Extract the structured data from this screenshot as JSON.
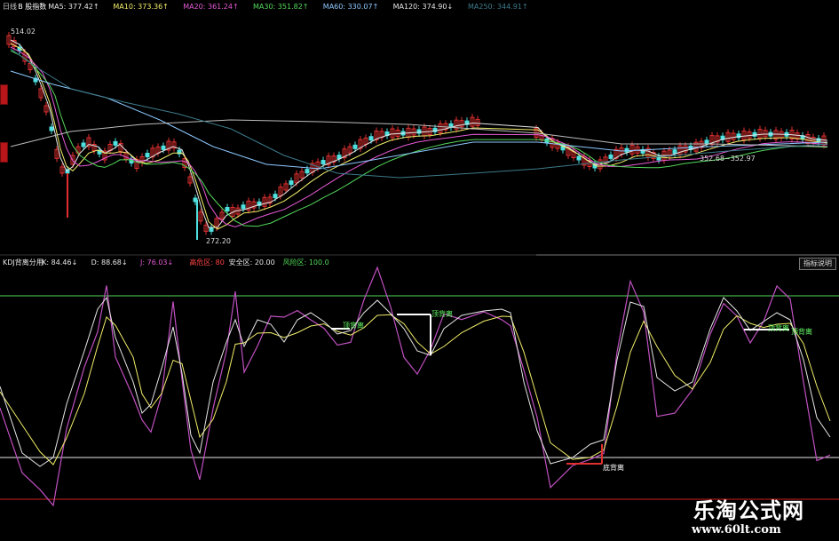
{
  "top_panel": {
    "legend": [
      {
        "text": "日线",
        "color": "#c9c9c9"
      },
      {
        "text": "B 股指数",
        "color": "#ffffff"
      },
      {
        "text": "MA5: 377.42↑",
        "color": "#e6e6e6"
      },
      {
        "text": "MA10: 373.36↑",
        "color": "#f2ee6a"
      },
      {
        "text": "MA20: 361.24↑",
        "color": "#e65ad6"
      },
      {
        "text": "MA30: 351.82↑",
        "color": "#53d85a"
      },
      {
        "text": "MA60: 330.07↑",
        "color": "#8dc8ff"
      },
      {
        "text": "MA120: 374.90↓",
        "color": "#e6e6e6"
      },
      {
        "text": "MA250: 344.91↑",
        "color": "#3d7a8a"
      }
    ],
    "high_label": "514.02",
    "low_label": "272.20",
    "range_label": "352.68~352.97"
  },
  "bottom_panel": {
    "legend": [
      {
        "text": "KDJ背离分用",
        "color": "#e6e6e6"
      },
      {
        "text": "K: 84.46↓",
        "color": "#e6e6e6"
      },
      {
        "text": "D: 88.68↓",
        "color": "#e6e6e6"
      },
      {
        "text": "J: 76.03↓",
        "color": "#e65ad6"
      },
      {
        "text": "高危区: 80",
        "color": "#ff4444"
      },
      {
        "text": "安全区: 20.00",
        "color": "#e6e6e6"
      },
      {
        "text": "风险区: 100.0",
        "color": "#53d85a"
      }
    ],
    "indicator_button": "指标说明",
    "annotations": {
      "top_divergence": "顶背离",
      "bottom_divergence": "底背离"
    }
  },
  "watermark": {
    "title": "乐淘公式网",
    "url": "www.60lt.com"
  },
  "colors": {
    "up": "#e03030",
    "down": "#4fe0e0",
    "K": "#e6e6e6",
    "D": "#f2ee6a",
    "J": "#c050c0"
  }
}
